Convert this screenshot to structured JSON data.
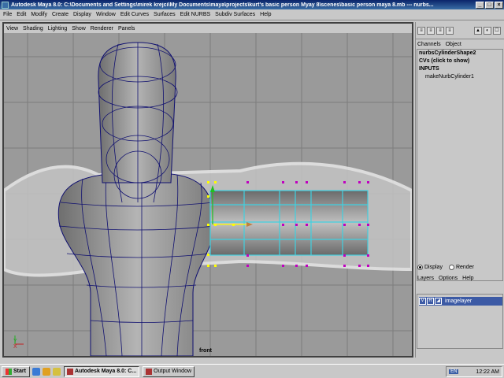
{
  "window": {
    "title": "Autodesk Maya 8.0: C:\\Documents and Settings\\mirek krejci\\My Documents\\maya\\projects\\kurt's basic person Myay 8\\scenes\\basic person maya 8.mb  ---  nurbs..."
  },
  "main_menu": [
    "File",
    "Edit",
    "Modify",
    "Create",
    "Display",
    "Window",
    "Edit Curves",
    "Surfaces",
    "Edit NURBS",
    "Subdiv Surfaces",
    "Help"
  ],
  "viewport": {
    "menu": [
      "View",
      "Shading",
      "Lighting",
      "Show",
      "Renderer",
      "Panels"
    ],
    "camera_label": "front",
    "axis_y": "Y",
    "axis_x": "X"
  },
  "channel_box": {
    "menu": [
      "Channels",
      "Object"
    ],
    "shape_name": "nurbsCylinderShape2",
    "cvs_label": "CVs (click to show)",
    "inputs_label": "INPUTS",
    "input_node": "makeNurbCylinder1"
  },
  "display_toggle": {
    "display_label": "Display",
    "render_label": "Render",
    "selected": "Display"
  },
  "layers_menu": [
    "Layers",
    "Options",
    "Help"
  ],
  "layers": [
    {
      "visible": "V",
      "render": "R",
      "name": "imagelayer"
    }
  ],
  "taskbar": {
    "start_label": "Start",
    "tasks": [
      {
        "label": "Autodesk Maya 8.0: C...",
        "active": true
      },
      {
        "label": "Output Window",
        "active": false
      }
    ],
    "language": "EN",
    "clock": "12:22 AM"
  },
  "colors": {
    "title_bar": "#0a246a",
    "wireframe": "#101070",
    "selected_surface": "#40d0e0",
    "cv_points": "#c000c0",
    "hull_points": "#ffff00",
    "layer_selected": "#3c5aa5"
  }
}
